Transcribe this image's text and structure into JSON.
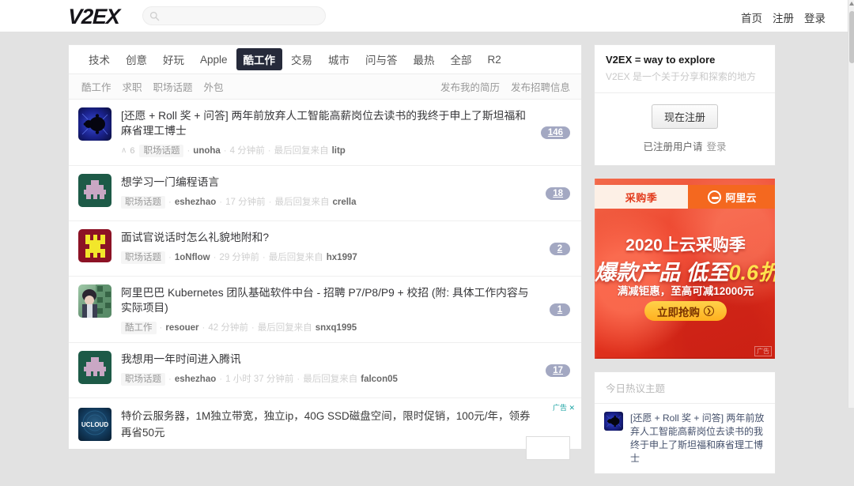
{
  "site": {
    "logo": "V2EX",
    "search_placeholder": "",
    "search_value": "",
    "nav": [
      {
        "label": "首页"
      },
      {
        "label": "注册"
      },
      {
        "label": "登录"
      }
    ]
  },
  "categories": [
    {
      "label": "技术",
      "active": false
    },
    {
      "label": "创意",
      "active": false
    },
    {
      "label": "好玩",
      "active": false
    },
    {
      "label": "Apple",
      "active": false
    },
    {
      "label": "酷工作",
      "active": true
    },
    {
      "label": "交易",
      "active": false
    },
    {
      "label": "城市",
      "active": false
    },
    {
      "label": "问与答",
      "active": false
    },
    {
      "label": "最热",
      "active": false
    },
    {
      "label": "全部",
      "active": false
    },
    {
      "label": "R2",
      "active": false
    }
  ],
  "subnav": {
    "left": [
      {
        "label": "酷工作"
      },
      {
        "label": "求职"
      },
      {
        "label": "职场话题"
      },
      {
        "label": "外包"
      }
    ],
    "right": [
      {
        "label": "发布我的简历"
      },
      {
        "label": "发布招聘信息"
      }
    ]
  },
  "topics": [
    {
      "title": "[还愿 + Roll 奖 + 问答] 两年前放弃人工智能高薪岗位去读书的我终于申上了斯坦福和麻省理工博士",
      "votes": "6",
      "node": "职场话题",
      "author": "unoha",
      "ago": "4 分钟前",
      "last_reply_label": "最后回复来自",
      "last_reply_user": "litp",
      "count": "146",
      "avatar": "mandelbrot-avatar"
    },
    {
      "title": "想学习一门编程语言",
      "votes": "",
      "node": "职场话题",
      "author": "eshezhao",
      "ago": "17 分钟前",
      "last_reply_label": "最后回复来自",
      "last_reply_user": "crella",
      "count": "18",
      "avatar": "identicon-green-avatar"
    },
    {
      "title": "面试官说话时怎么礼貌地附和?",
      "votes": "",
      "node": "职场话题",
      "author": "1oNflow",
      "ago": "29 分钟前",
      "last_reply_label": "最后回复来自",
      "last_reply_user": "hx1997",
      "count": "2",
      "avatar": "identicon-red-avatar"
    },
    {
      "title": "阿里巴巴 Kubernetes 团队基础软件中台 - 招聘 P7/P8/P9 + 校招 (附: 具体工作内容与实际项目)",
      "votes": "",
      "node": "酷工作",
      "author": "resouer",
      "ago": "42 分钟前",
      "last_reply_label": "最后回复来自",
      "last_reply_user": "snxq1995",
      "count": "1",
      "avatar": "photo-avatar"
    },
    {
      "title": "我想用一年时间进入腾讯",
      "votes": "",
      "node": "职场话题",
      "author": "eshezhao",
      "ago": "1 小时 37 分钟前",
      "last_reply_label": "最后回复来自",
      "last_reply_user": "falcon05",
      "count": "17",
      "avatar": "identicon-green-avatar"
    }
  ],
  "inline_ad": {
    "text": "特价云服务器，1M独立带宽，独立ip，40G SSD磁盘空间，限时促销，100元/年，领券再省50元",
    "flag": "广告 ✕",
    "logo": "UCLOUD"
  },
  "sidebar": {
    "promo": {
      "title": "V2EX = way to explore",
      "subtitle": "V2EX 是一个关于分享和探索的地方",
      "signup_label": "现在注册",
      "signin_prefix": "已注册用户请",
      "signin_label": "登录"
    },
    "banner": {
      "brand_left": "采购季",
      "brand_right": "阿里云",
      "line1": "2020上云采购季",
      "line2_a": "爆款产品  低至",
      "line2_b": "0.6",
      "line2_c": "折",
      "line3": "满减钜惠，至高可减12000元",
      "cta": "立即抢购",
      "mark": "广告"
    },
    "hot": {
      "heading": "今日热议主题",
      "items": [
        {
          "title": "[还愿 + Roll 奖 + 问答] 两年前放弃人工智能高薪岗位去读书的我终于申上了斯坦福和麻省理工博士",
          "avatar": "mandelbrot-avatar"
        }
      ]
    }
  }
}
